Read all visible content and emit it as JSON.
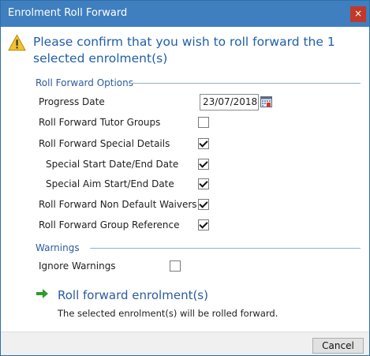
{
  "window": {
    "title": "Enrolment Roll Forward",
    "close_glyph": "×"
  },
  "header": {
    "icon": "warning-icon",
    "message": "Please confirm that you wish to roll forward the 1 selected enrolment(s)"
  },
  "options": {
    "group_title": "Roll Forward Options",
    "progress_date_label": "Progress Date",
    "progress_date_value": "23/07/2018",
    "items": [
      {
        "label": "Roll Forward Tutor Groups",
        "checked": false
      },
      {
        "label": "Roll Forward Special Details",
        "checked": true
      },
      {
        "label": "Special Start Date/End Date",
        "checked": true
      },
      {
        "label": "Special Aim Start/End Date",
        "checked": true
      },
      {
        "label": "Roll Forward Non Default Waivers",
        "checked": true
      },
      {
        "label": "Roll Forward Group Reference",
        "checked": true
      }
    ]
  },
  "warnings": {
    "group_title": "Warnings",
    "ignore_label": "Ignore Warnings",
    "ignore_checked": false
  },
  "action": {
    "icon": "arrow-right-icon",
    "title": "Roll forward enrolment(s)",
    "description": "The selected enrolment(s) will be rolled forward."
  },
  "footer": {
    "cancel_label": "Cancel"
  },
  "colors": {
    "titlebar": "#3f7fbf",
    "accent_text": "#1f5fa8",
    "close_button": "#c0392b",
    "arrow_green": "#2e9b2e"
  }
}
